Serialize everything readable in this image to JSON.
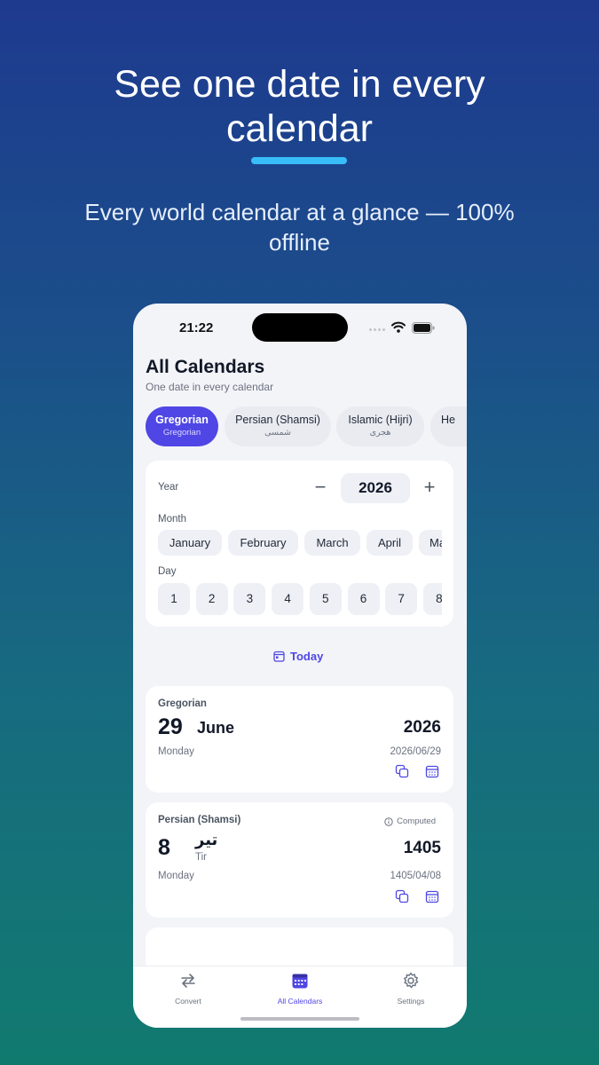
{
  "promo": {
    "headline_line1": "See one date in every",
    "headline_line2": "calendar",
    "subtitle_line1": "Every world calendar at a glance — 100%",
    "subtitle_line2": "offline",
    "accent_color": "#38bdf8"
  },
  "status_bar": {
    "time": "21:22",
    "icons": [
      "cellular-signal-icon",
      "wifi-icon",
      "battery-icon"
    ]
  },
  "screen": {
    "title": "All Calendars",
    "subtitle": "One date in every calendar"
  },
  "calendar_tabs": [
    {
      "label": "Gregorian",
      "sublabel": "Gregorian",
      "active": true
    },
    {
      "label": "Persian (Shamsi)",
      "sublabel": "شمسی",
      "active": false
    },
    {
      "label": "Islamic (Hijri)",
      "sublabel": "هجری",
      "active": false
    },
    {
      "label": "He",
      "sublabel": "",
      "active": false
    }
  ],
  "picker": {
    "year_label": "Year",
    "year_value": "2026",
    "minus_symbol": "−",
    "plus_symbol": "+",
    "month_label": "Month",
    "months": [
      "January",
      "February",
      "March",
      "April",
      "Ma"
    ],
    "day_label": "Day",
    "days": [
      "1",
      "2",
      "3",
      "4",
      "5",
      "6",
      "7",
      "8"
    ]
  },
  "today_button": {
    "label": "Today",
    "icon": "calendar-icon"
  },
  "results": [
    {
      "calendar": "Gregorian",
      "day": "29",
      "month": "June",
      "year": "2026",
      "weekday": "Monday",
      "numeric": "2026/06/29"
    },
    {
      "calendar": "Persian (Shamsi)",
      "badge": "Computed",
      "day": "8",
      "month": "تیر",
      "month_latin": "Tir",
      "year": "1405",
      "weekday": "Monday",
      "numeric": "1405/04/08"
    }
  ],
  "tab_bar": {
    "items": [
      {
        "label": "Convert",
        "icon": "arrows-exchange-icon",
        "active": false
      },
      {
        "label": "All Calendars",
        "icon": "calendar-grid-icon",
        "active": true
      },
      {
        "label": "Settings",
        "icon": "gear-icon",
        "active": false
      }
    ]
  },
  "colors": {
    "primary": "#4f46e5",
    "background_top": "#1e3a8f",
    "background_bottom": "#117a6f"
  }
}
